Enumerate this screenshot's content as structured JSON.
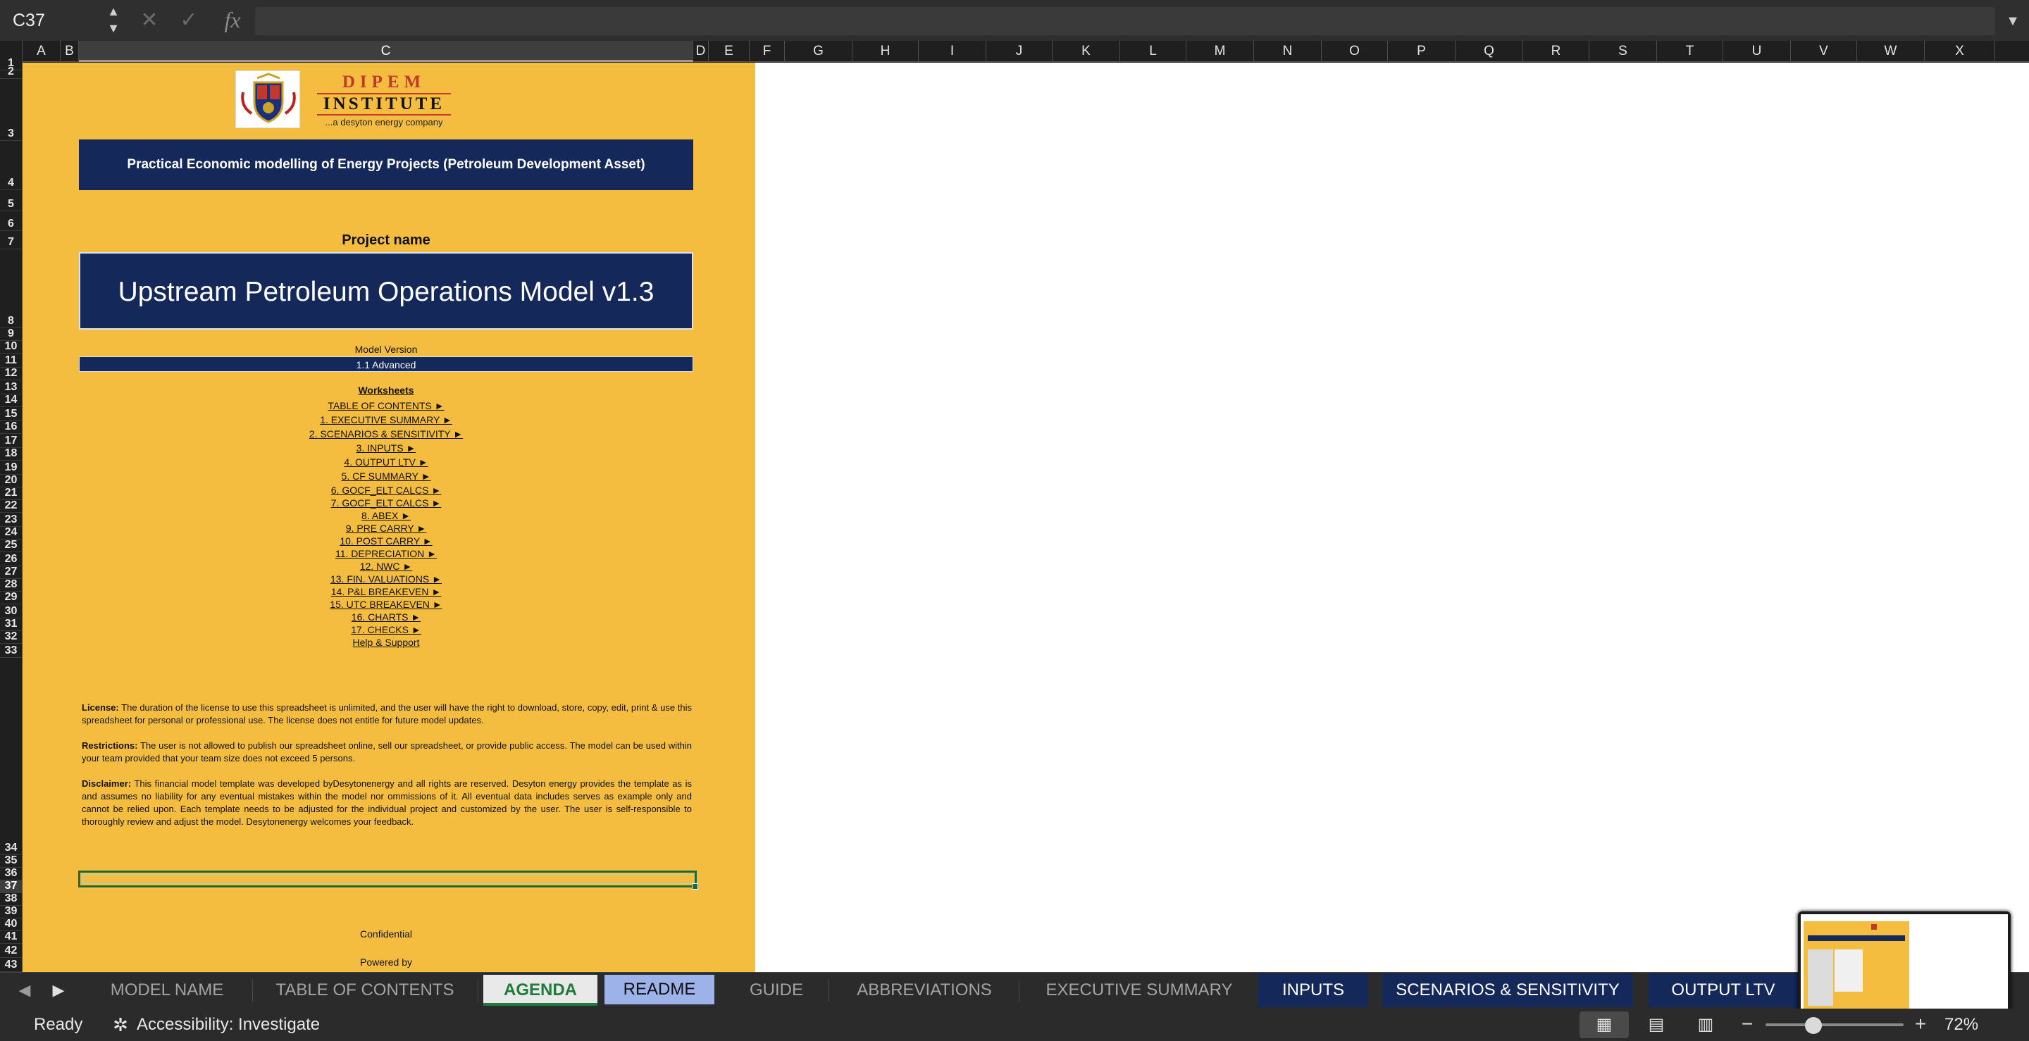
{
  "formula_bar": {
    "name_box": "C37",
    "fx": "fx",
    "formula": "",
    "cancel_icon": "close-icon",
    "enter_icon": "check-icon"
  },
  "columns": [
    "A",
    "B",
    "C",
    "D",
    "E",
    "F",
    "G",
    "H",
    "I",
    "J",
    "K",
    "L",
    "M",
    "N",
    "O",
    "P",
    "Q",
    "R",
    "S",
    "T",
    "U",
    "V",
    "W",
    "X"
  ],
  "rows": [
    "1",
    "2",
    "3",
    "4",
    "5",
    "6",
    "7",
    "8",
    "9",
    "10",
    "11",
    "12",
    "13",
    "14",
    "15",
    "16",
    "17",
    "18",
    "19",
    "20",
    "21",
    "22",
    "23",
    "24",
    "25",
    "26",
    "27",
    "28",
    "29",
    "30",
    "31",
    "32",
    "33",
    "34",
    "35",
    "36",
    "37",
    "38",
    "39",
    "40",
    "41",
    "42",
    "43"
  ],
  "selected_cell": {
    "column": "C",
    "row": "37"
  },
  "sheet": {
    "logo": {
      "title": "DIPEM",
      "subtitle": "INSTITUTE",
      "tagline": "...a desyton energy company"
    },
    "course_banner": "Practical Economic modelling of Energy Projects (Petroleum Development Asset)",
    "project_label": "Project name",
    "project_name": "Upstream Petroleum Operations Model v1.3",
    "model_version_label": "Model Version",
    "model_version": "1.1 Advanced",
    "worksheets_title": "Worksheets",
    "worksheet_links": [
      "TABLE OF CONTENTS  ►",
      "1.  EXECUTIVE SUMMARY  ►",
      "2.  SCENARIOS & SENSITIVITY  ►",
      "3.  INPUTS  ►",
      "4.  OUTPUT LTV  ►",
      "5.  CF SUMMARY  ►",
      "6.  GOCF_ELT CALCS  ►",
      "7.  GOCF_ELT CALCS  ►",
      "8.  ABEX  ►",
      "9.  PRE CARRY  ►",
      "10.  POST CARRY  ►",
      "11.  DEPRECIATION  ►",
      "12.  NWC  ►",
      "13.  FIN. VALUATIONS  ►",
      "14.  P&L BREAKEVEN  ►",
      "15.  UTC BREAKEVEN  ►",
      "16.  CHARTS  ►",
      "17.  CHECKS  ►",
      "Help & Support"
    ],
    "license_label": "License:",
    "license_text": " The duration of the license to use this spreadsheet is unlimited, and the user will have the right to download, store, copy, edit, print & use this spreadsheet for personal or professional use. The license does not entitle for future model updates.",
    "restrictions_label": "Restrictions:",
    "restrictions_text": " The user is not allowed to publish our spreadsheet online, sell our spreadsheet, or provide public access. The model can be used within your team provided that your team size does not exceed 5 persons.",
    "disclaimer_label": "Disclaimer:",
    "disclaimer_text": " This financial model template was developed byDesytonenergy and all rights are reserved. Desyton energy provides the template as is and assumes no liability for any eventual mistakes within the model nor ommissions of it. All eventual data includes serves as example only and cannot be relied upon. Each template needs to be adjusted for the individual project and customized by the user. The user is self-responsible to thoroughly review and adjust the model. Desytonenergy welcomes your feedback.",
    "confidential": "Confidential",
    "powered_by": "Powered by"
  },
  "tabs": [
    "MODEL NAME",
    "TABLE OF CONTENTS",
    "AGENDA",
    "README",
    "GUIDE",
    "ABBREVIATIONS",
    "EXECUTIVE SUMMARY",
    "INPUTS",
    "SCENARIOS & SENSITIVITY",
    "OUTPUT LTV"
  ],
  "active_tab": "AGENDA",
  "status": {
    "ready": "Ready",
    "accessibility": "Accessibility: Investigate",
    "zoom": "72%"
  },
  "colors": {
    "sheet_fill": "#f5bd40",
    "navy": "#14285a",
    "active_tab_text": "#1e7b3a",
    "readme_tab": "#9db2e8"
  }
}
